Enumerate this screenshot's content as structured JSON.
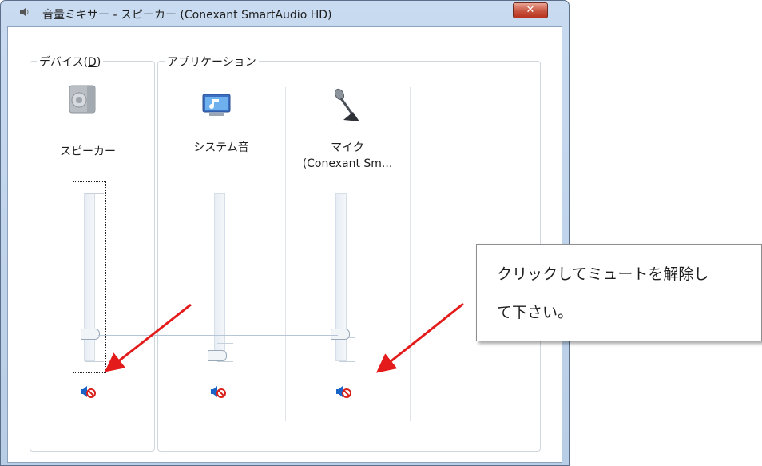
{
  "window": {
    "title": "音量ミキサー - スピーカー (Conexant SmartAudio HD)",
    "title_icon": "speaker-icon",
    "close_label": "✕"
  },
  "groups": {
    "device_label": "デバイス(D)",
    "application_label": "アプリケーション"
  },
  "channels": [
    {
      "name": "スピーカー",
      "icon": "speaker-device-icon",
      "volume_level": 0.09,
      "muted": true
    },
    {
      "name": "システム音",
      "icon": "system-sounds-icon",
      "volume_level": 0.0,
      "muted": true
    },
    {
      "name_line1": "マイク",
      "name_line2": "(Conexant Sm...",
      "icon": "microphone-icon",
      "volume_level": 0.09,
      "muted": true
    }
  ],
  "callout": {
    "line1": "クリックしてミュートを解除し",
    "line2": "て下さい。"
  },
  "colors": {
    "arrow": "#e31b1b",
    "mute_speaker": "#1a64c8",
    "mute_badge": "#d9221c"
  }
}
